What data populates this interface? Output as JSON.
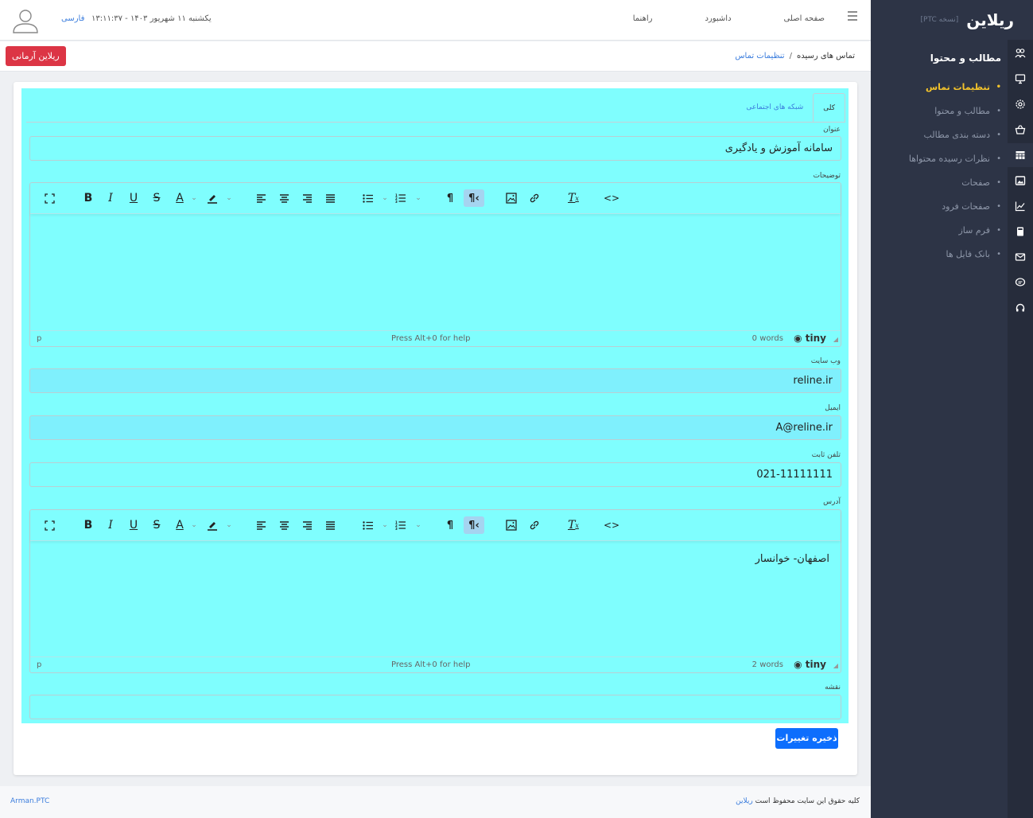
{
  "sidebar": {
    "logo_text": "ریلاین",
    "version": "[نسخه PTC]",
    "section_title": "مطالب و محتوا",
    "items": [
      {
        "label": "تنظیمات تماس"
      },
      {
        "label": "مطالب و محتوا"
      },
      {
        "label": "دسته بندی مطالب"
      },
      {
        "label": "نظرات رسیده محتواها"
      },
      {
        "label": "صفحات"
      },
      {
        "label": "صفحات فرود"
      },
      {
        "label": "فرم ساز"
      },
      {
        "label": "بانک فایل ها"
      }
    ],
    "active_index": 0,
    "active_color": "#f3c32b"
  },
  "topbar": {
    "nav": [
      "صفحه اصلی",
      "داشبورد",
      "راهنما"
    ],
    "datetime": "یکشنبه ۱۱ شهریور ۱۴۰۳ - ۱۳:۱۱:۳۷",
    "language": "فارسی"
  },
  "breadcrumb": {
    "root": "تماس های رسیده",
    "separator": "/",
    "current": "تنظیمات تماس"
  },
  "user_button": "ریلاین آرمانی",
  "tabs": [
    {
      "label": "کلی",
      "active": true
    },
    {
      "label": "شبکه های اجتماعی",
      "active": false
    }
  ],
  "form": {
    "title_label": "عنوان",
    "title_value": "سامانه آموزش و یادگیری",
    "description_label": "توضیحات",
    "description_editor": {
      "path": "p",
      "help": "Press Alt+0 for help",
      "words": "0 words",
      "brand": "tiny",
      "content": ""
    },
    "website_label": "وب سایت",
    "website_value": "reline.ir",
    "email_label": "ایمیل",
    "email_value": "A@reline.ir",
    "phone_label": "تلفن ثابت",
    "phone_value": "021-11111111",
    "address_label": "آدرس",
    "address_editor": {
      "path": "p",
      "help": "Press Alt+0 for help",
      "words": "2 words",
      "brand": "tiny",
      "content": "اصفهان- خوانسار"
    },
    "map_label": "نقشه",
    "map_value": ""
  },
  "save_button": "ذخیره تغییرات",
  "footer": {
    "left": "Arman.PTC",
    "right_text": "کلیه حقوق این سایت محفوظ است",
    "right_link": "ریلاین"
  },
  "colors": {
    "form_bg": "#7ffefe",
    "primary": "#0d6efd",
    "danger": "#dc3545",
    "sidebar": "#2d3446"
  }
}
